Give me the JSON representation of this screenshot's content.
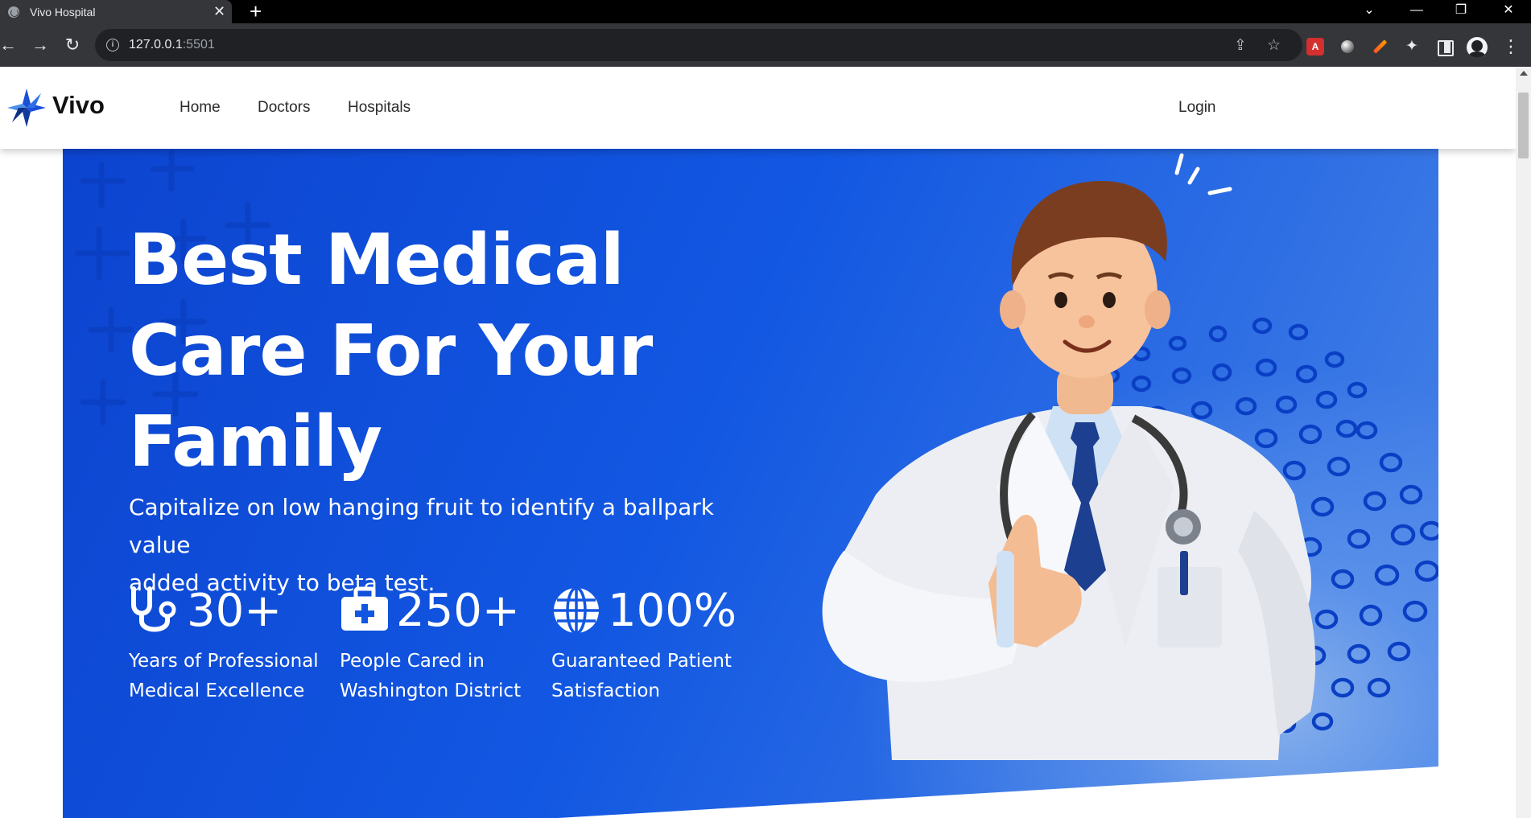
{
  "browser": {
    "tab_title": "Vivo Hospital",
    "tab_close": "✕",
    "new_tab": "+",
    "url_host": "127.0.0.1",
    "url_port": ":5501",
    "window_controls": {
      "list": "⌄",
      "minimize": "—",
      "restore": "❐",
      "close": "✕"
    }
  },
  "site": {
    "brand": "Vivo",
    "nav": {
      "home": "Home",
      "doctors": "Doctors",
      "hospitals": "Hospitals",
      "login": "Login"
    }
  },
  "hero": {
    "headline_line1": "Best Medical",
    "headline_line2": "Care For Your",
    "headline_line3": "Family",
    "subtext_line1": "Capitalize on low hanging fruit to identify a ballpark value",
    "subtext_line2": "added activity to beta test.",
    "stats": [
      {
        "icon": "stethoscope-icon",
        "value": "30+",
        "label_line1": "Years of Professional",
        "label_line2": "Medical Excellence"
      },
      {
        "icon": "medical-kit-icon",
        "value": "250+",
        "label_line1": "People Cared in",
        "label_line2": "Washington District"
      },
      {
        "icon": "globe-icon",
        "value": "100%",
        "label_line1": "Guaranteed Patient",
        "label_line2": "Satisfaction"
      }
    ]
  },
  "colors": {
    "hero_blue": "#1257e2",
    "hero_deep": "#0c44cf",
    "dot_pattern": "#0a3fc4",
    "text_on_hero": "#ffffff"
  }
}
